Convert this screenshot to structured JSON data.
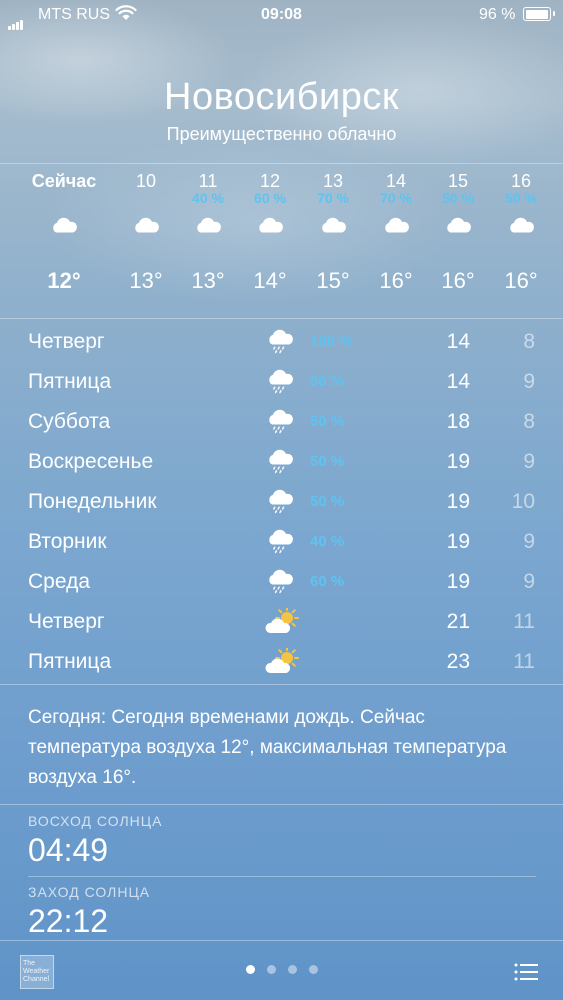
{
  "status_bar": {
    "carrier": "MTS RUS",
    "time": "09:08",
    "battery": "96 %",
    "signal_icon": "signal-icon",
    "wifi_icon": "wifi-icon",
    "battery_icon": "battery-icon"
  },
  "header": {
    "city": "Новосибирск",
    "condition": "Преимущественно облачно"
  },
  "hourly": [
    {
      "label": "Сейчас",
      "precip": "",
      "icon": "cloud-icon",
      "temp": "12°"
    },
    {
      "label": "10",
      "precip": "",
      "icon": "cloud-icon",
      "temp": "13°"
    },
    {
      "label": "11",
      "precip": "40 %",
      "icon": "cloud-icon",
      "temp": "13°"
    },
    {
      "label": "12",
      "precip": "60 %",
      "icon": "rain-cloud-icon",
      "temp": "14°"
    },
    {
      "label": "13",
      "precip": "70 %",
      "icon": "rain-cloud-icon",
      "temp": "15°"
    },
    {
      "label": "14",
      "precip": "70 %",
      "icon": "rain-cloud-icon",
      "temp": "16°"
    },
    {
      "label": "15",
      "precip": "50 %",
      "icon": "rain-cloud-icon",
      "temp": "16°"
    },
    {
      "label": "16",
      "precip": "50 %",
      "icon": "rain-cloud-icon",
      "temp": "16°"
    }
  ],
  "daily": [
    {
      "day": "Четверг",
      "icon": "rain-cloud-icon",
      "precip": "100 %",
      "high": "14",
      "low": "8"
    },
    {
      "day": "Пятница",
      "icon": "rain-cloud-icon",
      "precip": "90 %",
      "high": "14",
      "low": "9"
    },
    {
      "day": "Суббота",
      "icon": "rain-cloud-icon",
      "precip": "50 %",
      "high": "18",
      "low": "8"
    },
    {
      "day": "Воскресенье",
      "icon": "rain-cloud-icon",
      "precip": "50 %",
      "high": "19",
      "low": "9"
    },
    {
      "day": "Понедельник",
      "icon": "rain-cloud-icon",
      "precip": "50 %",
      "high": "19",
      "low": "10"
    },
    {
      "day": "Вторник",
      "icon": "rain-cloud-icon",
      "precip": "40 %",
      "high": "19",
      "low": "9"
    },
    {
      "day": "Среда",
      "icon": "rain-cloud-icon",
      "precip": "60 %",
      "high": "19",
      "low": "9"
    },
    {
      "day": "Четверг",
      "icon": "partly-sunny-icon",
      "precip": "",
      "high": "21",
      "low": "11"
    },
    {
      "day": "Пятница",
      "icon": "partly-sunny-icon",
      "precip": "",
      "high": "23",
      "low": "11"
    }
  ],
  "summary": "Сегодня: Сегодня временами дождь. Сейчас температура воздуха 12°, максимальная температура воздуха 16°.",
  "details": {
    "sunrise_label": "ВОСХОД СОЛНЦА",
    "sunrise_value": "04:49",
    "sunset_label": "ЗАХОД СОЛНЦА",
    "sunset_value": "22:12"
  },
  "footer": {
    "logo_text": "The Weather Channel",
    "pages": 4,
    "active_page": 1,
    "list_icon": "list-icon"
  },
  "colors": {
    "precip_accent": "#5fc3f0",
    "sky_top": "#9fb3c3",
    "sky_bottom": "#5f93c7"
  }
}
